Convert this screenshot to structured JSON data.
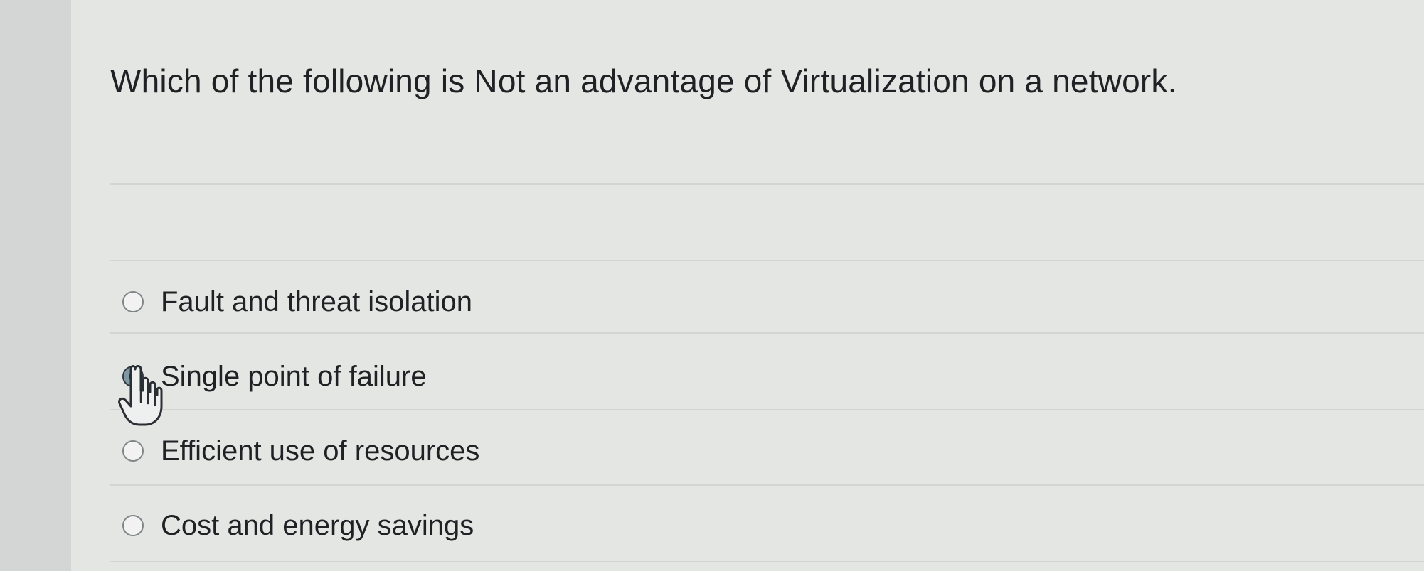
{
  "question": {
    "text": "Which of the following is Not an advantage of Virtualization on a network."
  },
  "options": [
    {
      "label": "Fault and threat isolation",
      "selected": false
    },
    {
      "label": "Single point of failure",
      "selected": true
    },
    {
      "label": "Efficient use of resources",
      "selected": false
    },
    {
      "label": "Cost and energy savings",
      "selected": false
    }
  ],
  "icons": {
    "radio_unselected": "radio-unselected-icon",
    "radio_selected": "radio-selected-icon",
    "cursor": "hand-pointer-cursor-icon"
  },
  "colors": {
    "background": "#e4e6e4",
    "text": "#1f2224",
    "radio_border": "#7f8487",
    "radio_selected_fill": "#1f2b38"
  }
}
